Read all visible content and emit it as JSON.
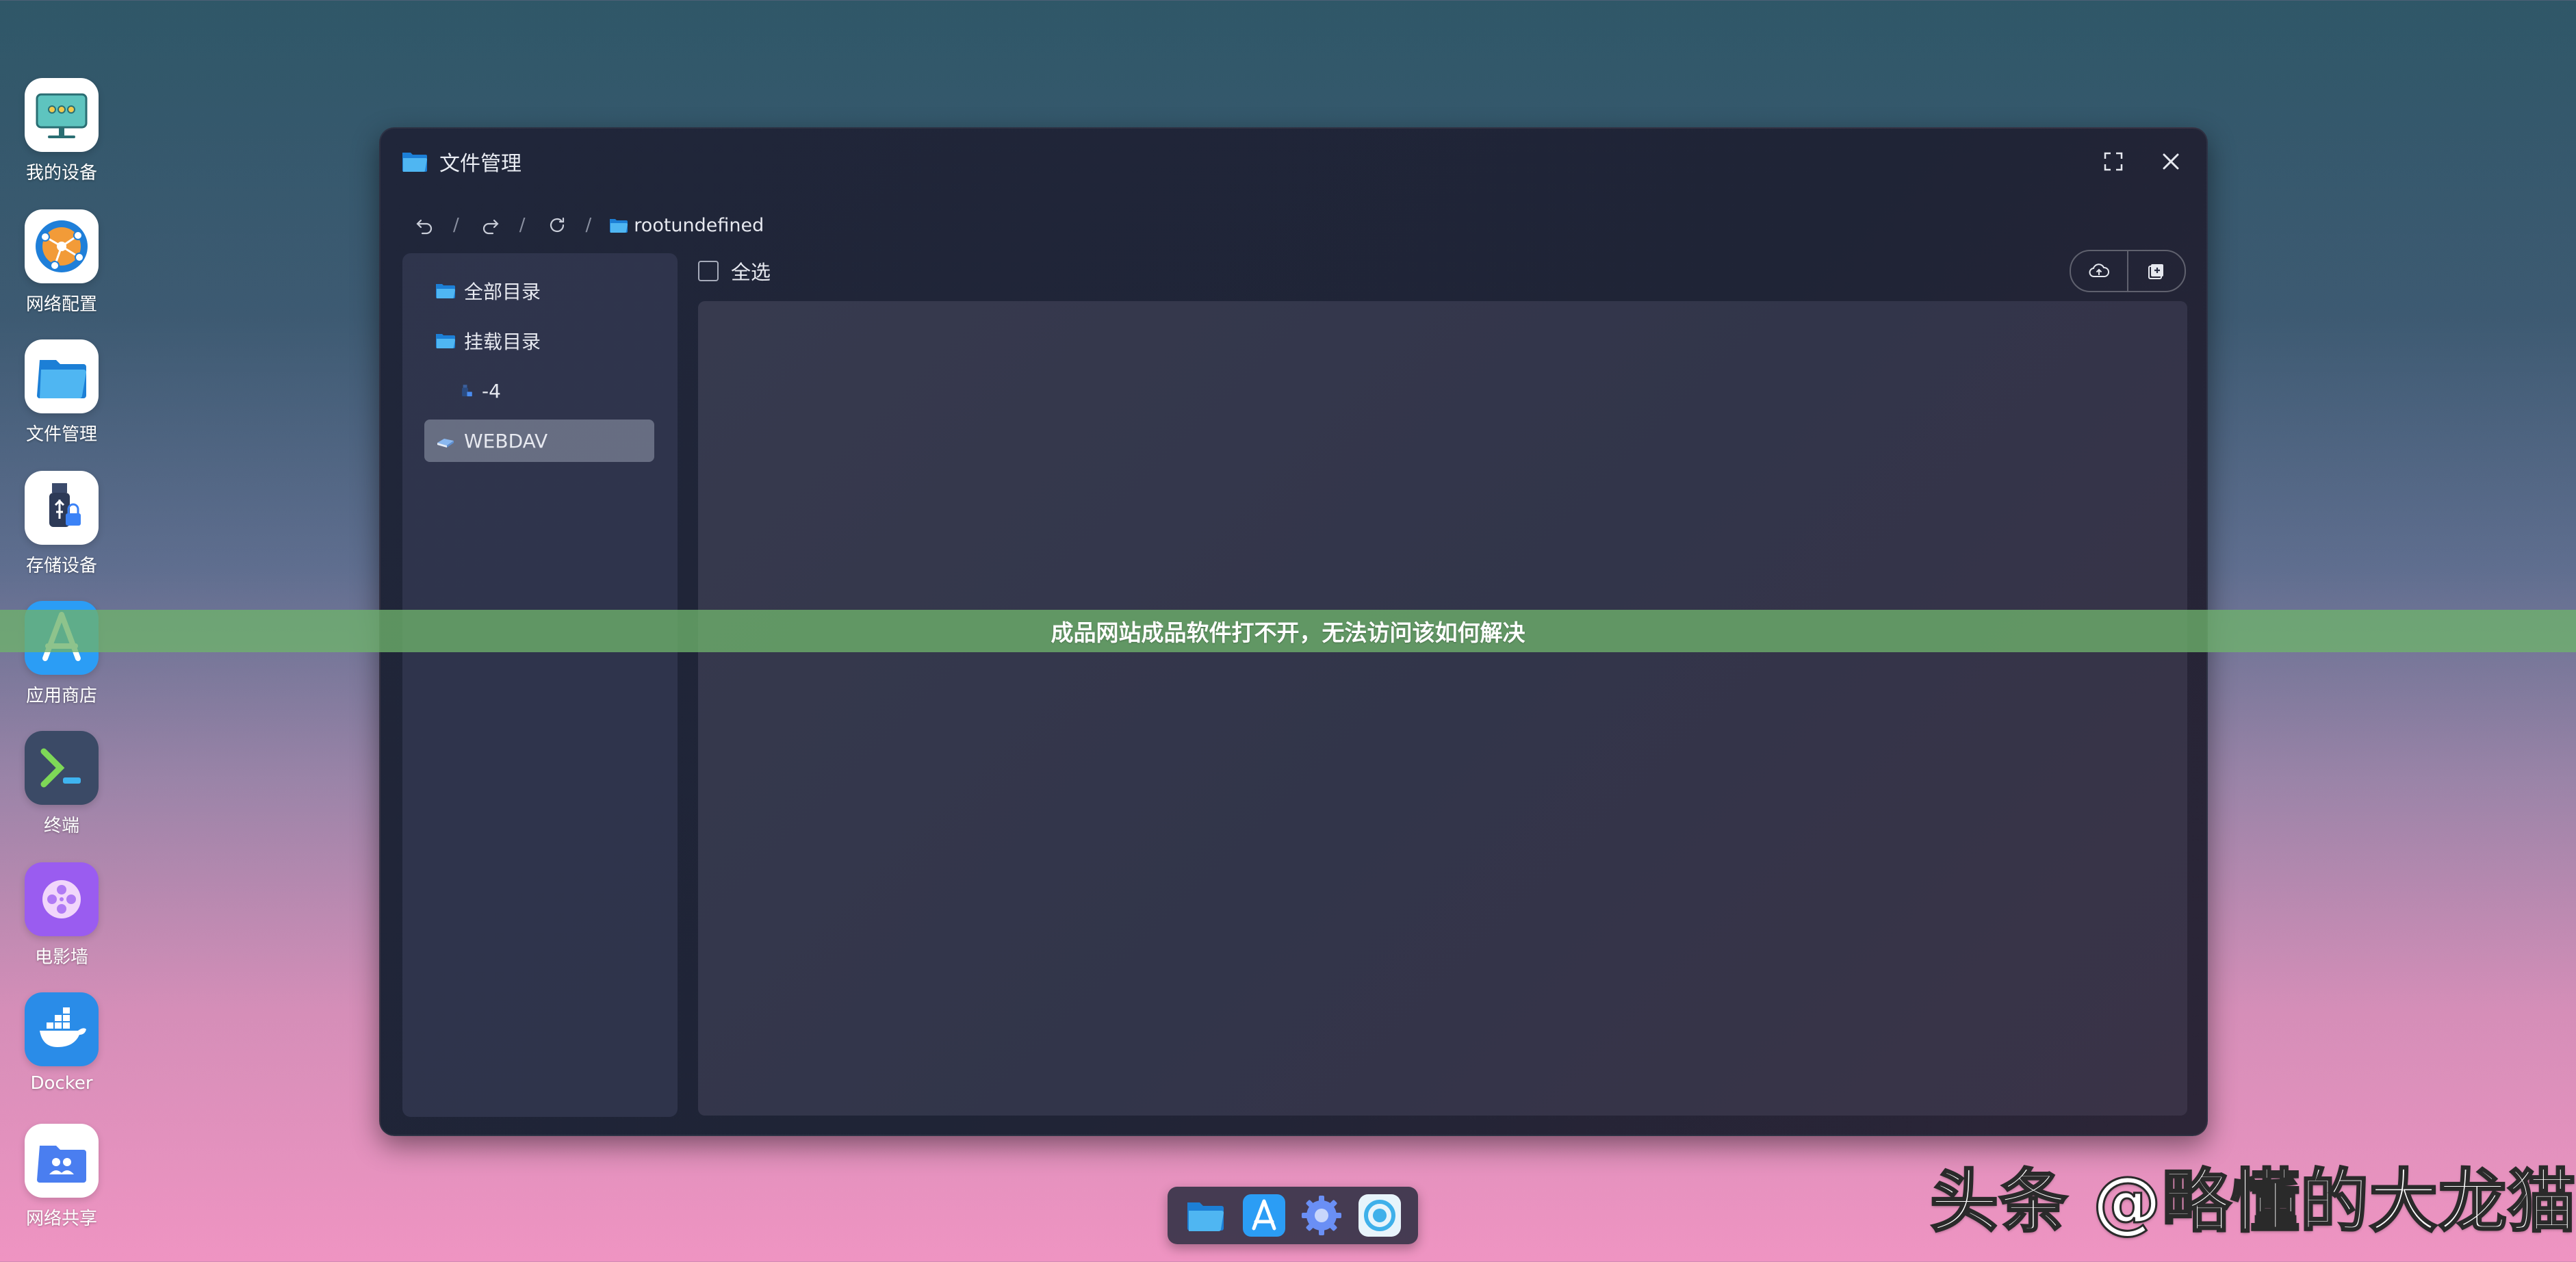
{
  "desktop": {
    "icons": [
      {
        "label": "我的设备",
        "icon": "monitor-icon"
      },
      {
        "label": "网络配置",
        "icon": "network-globe-icon"
      },
      {
        "label": "文件管理",
        "icon": "folder-icon"
      },
      {
        "label": "存储设备",
        "icon": "usb-storage-icon"
      },
      {
        "label": "应用商店",
        "icon": "app-store-icon"
      },
      {
        "label": "终端",
        "icon": "terminal-icon"
      },
      {
        "label": "电影墙",
        "icon": "movie-reel-icon"
      },
      {
        "label": "Docker",
        "icon": "docker-whale-icon"
      },
      {
        "label": "网络共享",
        "icon": "shared-folder-icon"
      }
    ]
  },
  "window": {
    "title": "文件管理",
    "nav": {
      "separator": "/",
      "breadcrumb": "rootundefined"
    },
    "sidebar": {
      "items": [
        {
          "label": "全部目录",
          "icon": "folder-icon"
        },
        {
          "label": "挂载目录",
          "icon": "folder-icon"
        },
        {
          "label": "-4",
          "icon": "usb-drive-icon"
        },
        {
          "label": "WEBDAV",
          "icon": "cloud-drive-icon",
          "active": true
        }
      ]
    },
    "toolbar": {
      "select_all": "全选",
      "upload_icon": "cloud-upload-icon",
      "new_folder_icon": "add-folder-icon"
    }
  },
  "banner": {
    "text": "成品网站成品软件打不开，无法访问该如何解决"
  },
  "dock": {
    "items": [
      "folder-icon",
      "app-store-icon",
      "settings-gear-icon",
      "circle-app-icon"
    ]
  },
  "watermark": {
    "text": "头条 @略懂的大龙猫"
  },
  "colors": {
    "accent_blue": "#2b8ff0",
    "banner_green": "#6eb26c",
    "window_bg": "#20263a"
  }
}
